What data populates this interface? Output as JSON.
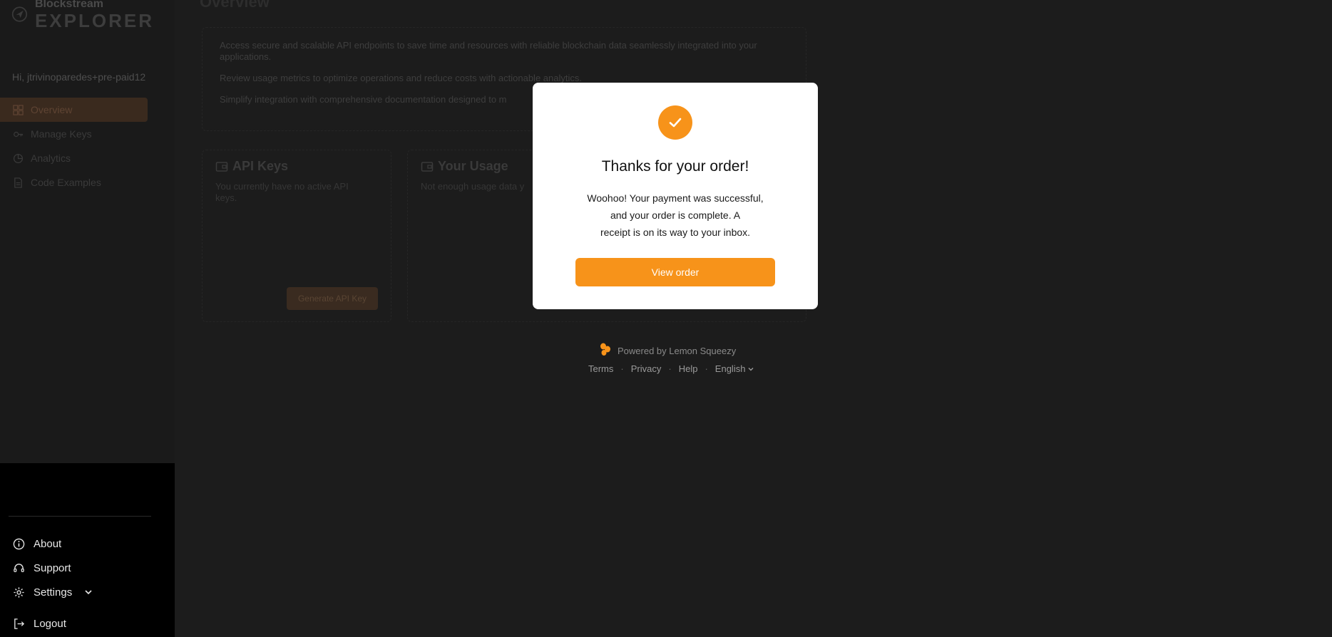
{
  "brand": {
    "line1": "Blockstream",
    "line2": "EXPLORER"
  },
  "greeting": "Hi, jtrivinoparedes+pre-paid12",
  "nav": [
    {
      "label": "Overview",
      "icon": "dashboard-icon",
      "active": true
    },
    {
      "label": "Manage Keys",
      "icon": "key-icon"
    },
    {
      "label": "Analytics",
      "icon": "analytics-icon"
    },
    {
      "label": "Code Examples",
      "icon": "document-icon"
    }
  ],
  "bottom_nav": {
    "about": "About",
    "support": "Support",
    "settings": "Settings",
    "logout": "Logout"
  },
  "main": {
    "title": "Overview",
    "intro": [
      "Access secure and scalable API endpoints to save time and resources with reliable blockchain data seamlessly integrated into your applications.",
      "Review usage metrics to optimize operations and reduce costs with actionable analytics.",
      "Simplify integration with comprehensive documentation designed to m"
    ],
    "api_keys": {
      "title": "API Keys",
      "body": "You currently have no active API keys.",
      "button": "Generate API Key"
    },
    "usage": {
      "title": "Your Usage",
      "body": "Not enough usage data y"
    }
  },
  "footer": {
    "powered": "Powered by Lemon Squeezy",
    "terms": "Terms",
    "privacy": "Privacy",
    "help": "Help",
    "language": "English",
    "separator": "·"
  },
  "modal": {
    "title": "Thanks for your order!",
    "line1": "Woohoo! Your payment was successful,",
    "line2": "and your order is complete. A",
    "line3": "receipt is on its way to your inbox.",
    "button": "View order"
  },
  "colors": {
    "accent": "#f7931a",
    "lemon": "#f7931a"
  }
}
